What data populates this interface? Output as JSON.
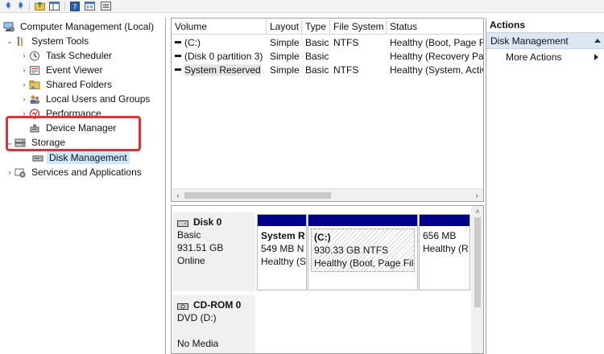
{
  "tree": {
    "root": "Computer Management (Local)",
    "system_tools": "System Tools",
    "task_scheduler": "Task Scheduler",
    "event_viewer": "Event Viewer",
    "shared_folders": "Shared Folders",
    "local_users": "Local Users and Groups",
    "performance": "Performance",
    "device_manager": "Device Manager",
    "storage": "Storage",
    "disk_management": "Disk Management",
    "services": "Services and Applications"
  },
  "volumes": {
    "headers": [
      "Volume",
      "Layout",
      "Type",
      "File System",
      "Status"
    ],
    "rows": [
      {
        "volume": "(C:)",
        "layout": "Simple",
        "type": "Basic",
        "fs": "NTFS",
        "status": "Healthy (Boot, Page Fi"
      },
      {
        "volume": "(Disk 0 partition 3)",
        "layout": "Simple",
        "type": "Basic",
        "fs": "",
        "status": "Healthy (Recovery Par"
      },
      {
        "volume": "System Reserved",
        "layout": "Simple",
        "type": "Basic",
        "fs": "NTFS",
        "status": "Healthy (System, Activ"
      }
    ]
  },
  "disk0": {
    "name": "Disk 0",
    "type": "Basic",
    "size": "931.51 GB",
    "state": "Online",
    "partitions": [
      {
        "name": "System R",
        "size": "549 MB N",
        "status": "Healthy (S"
      },
      {
        "name": "(C:)",
        "size": "930.33 GB NTFS",
        "status": "Healthy (Boot, Page File,"
      },
      {
        "name": "",
        "size": "656 MB",
        "status": "Healthy (R"
      }
    ]
  },
  "cdrom": {
    "name": "CD-ROM 0",
    "type": "DVD (D:)",
    "media": "No Media"
  },
  "actions": {
    "title": "Actions",
    "section": "Disk Management",
    "more": "More Actions"
  },
  "colors": {
    "partition_bar": "#00008b",
    "selection": "#cce8ff",
    "highlight": "#e0313a",
    "action_section": "#dde7f3"
  }
}
